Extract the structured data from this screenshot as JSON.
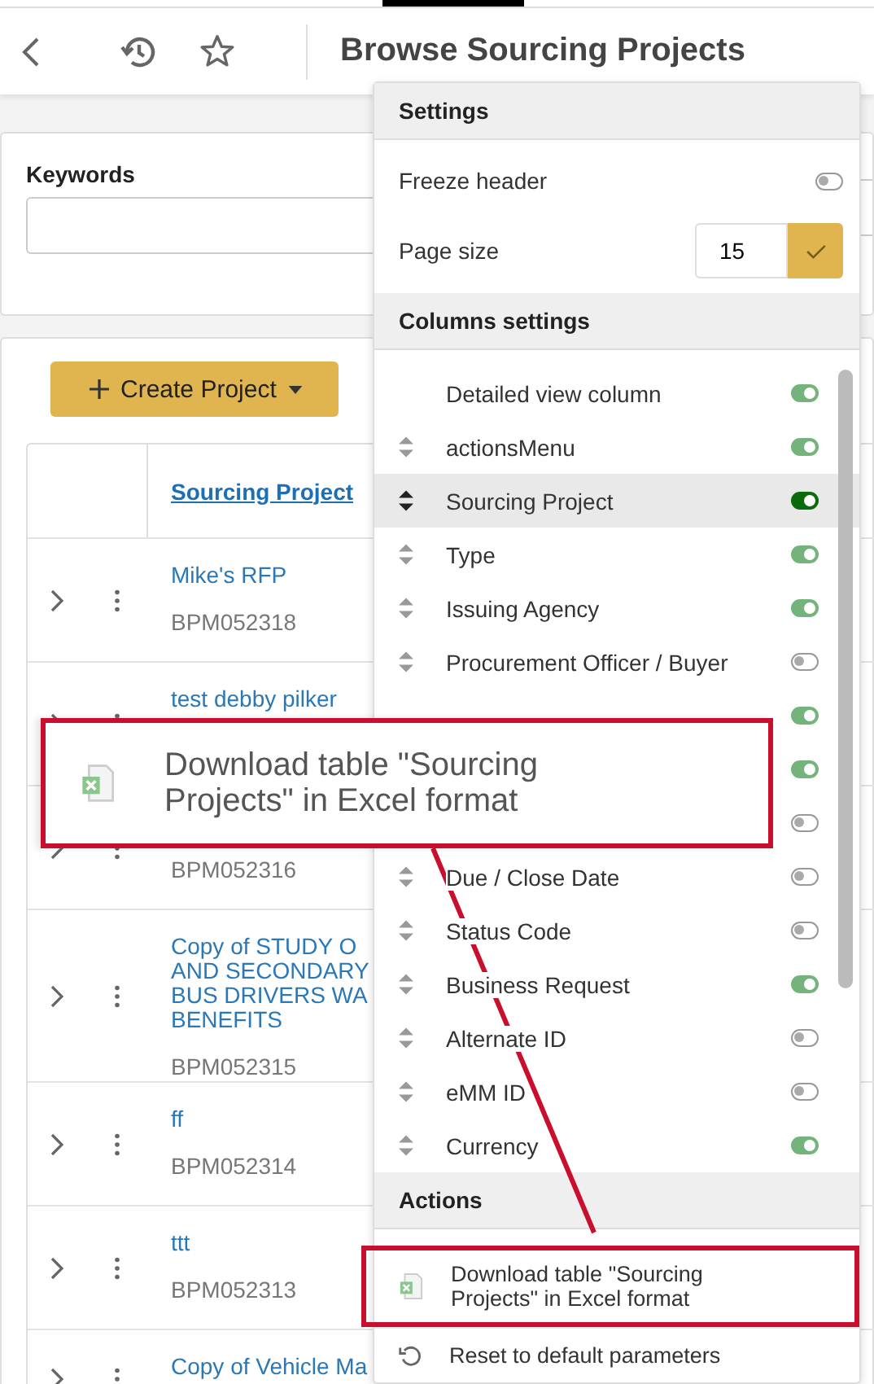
{
  "header": {
    "title": "Browse Sourcing Projects"
  },
  "filters": {
    "fields": [
      {
        "label": "Keywords"
      }
    ]
  },
  "create_button": {
    "label": "Create Project"
  },
  "table": {
    "columns": [
      {
        "label": "Sourcing Project"
      }
    ],
    "rows": [
      {
        "name": [
          "Mike's RFP"
        ],
        "id": "BPM052318"
      },
      {
        "name": [
          "test debby pilker"
        ]
      },
      {
        "id": "BPM052316"
      },
      {
        "name": [
          "Copy of STUDY O",
          "AND SECONDARY",
          "BUS DRIVERS WA",
          "BENEFITS"
        ],
        "id": "BPM052315"
      },
      {
        "name": [
          "ff"
        ],
        "id": "BPM052314"
      },
      {
        "name": [
          "ttt"
        ],
        "id": "BPM052313"
      },
      {
        "name": [
          "Copy of Vehicle Ma"
        ]
      }
    ]
  },
  "menu": {
    "settings_title": "Settings",
    "freeze_header": {
      "label": "Freeze header",
      "on": false
    },
    "page_size": {
      "label": "Page size",
      "value": "15"
    },
    "columns_title": "Columns settings",
    "columns": [
      {
        "label": "Detailed view column",
        "draggable": false,
        "on": true,
        "selected": false
      },
      {
        "label": "actionsMenu",
        "draggable": true,
        "on": true,
        "selected": false
      },
      {
        "label": "Sourcing Project",
        "draggable": true,
        "on": true,
        "selected": true
      },
      {
        "label": "Type",
        "draggable": true,
        "on": true,
        "selected": false
      },
      {
        "label": "Issuing Agency",
        "draggable": true,
        "on": true,
        "selected": false
      },
      {
        "label": "Procurement Officer / Buyer",
        "draggable": true,
        "on": false,
        "selected": false
      },
      {
        "on": true,
        "selected": false
      },
      {
        "on": true,
        "selected": false
      },
      {
        "on": false,
        "selected": false
      },
      {
        "label": "Due / Close Date",
        "draggable": true,
        "on": false,
        "selected": false
      },
      {
        "label": "Status Code",
        "draggable": true,
        "on": false,
        "selected": false
      },
      {
        "label": "Business Request",
        "draggable": true,
        "on": true,
        "selected": false
      },
      {
        "label": "Alternate ID",
        "draggable": true,
        "on": false,
        "selected": false
      },
      {
        "label": "eMM ID",
        "draggable": true,
        "on": false,
        "selected": false
      },
      {
        "label": "Currency",
        "draggable": true,
        "on": true,
        "selected": false
      }
    ],
    "actions_title": "Actions",
    "actions": [
      {
        "kind": "excel",
        "label": "Download table \"Sourcing Projects\" in Excel format"
      },
      {
        "kind": "reset",
        "label": "Reset to default parameters"
      }
    ]
  },
  "annotation": {
    "text": "Download table \"Sourcing Projects\" in Excel format"
  }
}
